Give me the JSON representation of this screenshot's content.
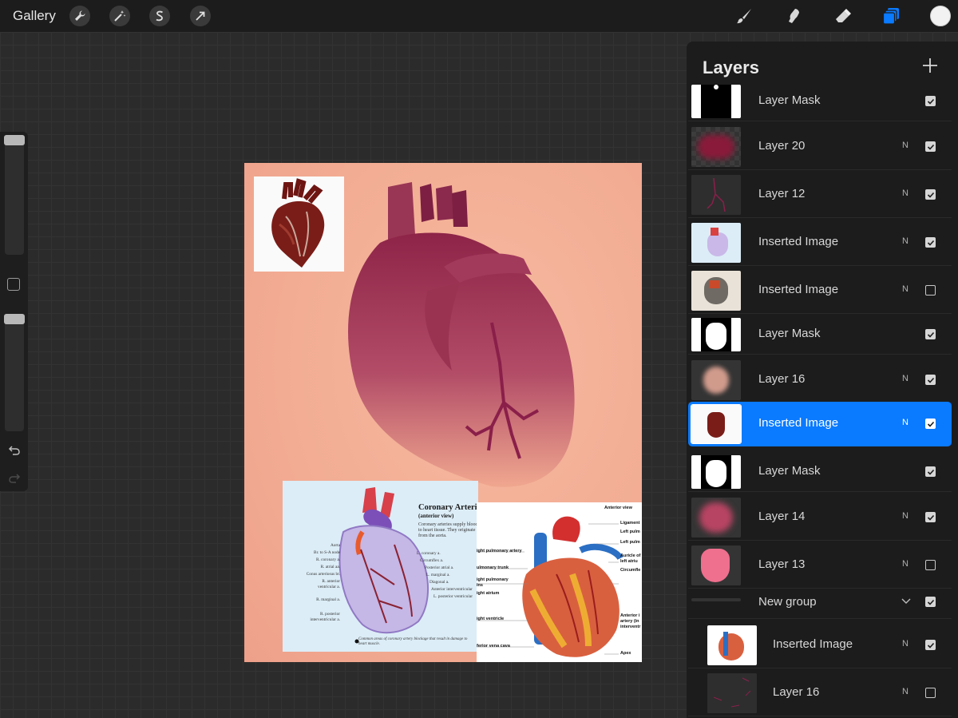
{
  "topbar": {
    "gallery_label": "Gallery",
    "tools_left": [
      "wrench-icon",
      "magic-wand-icon",
      "selection-s-icon",
      "transform-arrow-icon"
    ],
    "tools_right": [
      "brush-icon",
      "smudge-icon",
      "eraser-icon",
      "layers-icon"
    ],
    "active_tool": "layers-icon",
    "accent_color": "#0a7aff",
    "current_color": "#f2f2f2"
  },
  "sidebar": {
    "brush_size_level": 0.95,
    "opacity_level": 0.95
  },
  "artwork": {
    "diagram_left": {
      "title": "Coronary Arteries",
      "subtitle": "(anterior view)",
      "description": "Coronary arteries supply blood to heart tissue. They originate from the aorta.",
      "caption": "Common areas of coronary artery blockage that result in damage to heart muscle.",
      "labels_left": [
        "Aorta",
        "Br. to S-A node",
        "R. coronary a.",
        "R. atrial aa.",
        "Conus arteriosus br.",
        "R. anterior",
        "ventricular a.",
        "R. marginal a.",
        "R. posterior",
        "interventricular a."
      ],
      "labels_right": [
        "L. coronary a.",
        "Circumflex a.",
        "Posterior atrial a.",
        "L. marginal a.",
        "Diagonal a.",
        "Anterior interventricular",
        "L. posterior ventricular"
      ]
    },
    "diagram_right": {
      "header": "Anterior view",
      "labels_left": [
        "ight pulmonary artery",
        "ulmonary trunk",
        "ight pulmonary",
        "ins",
        "ight atrium",
        "ight ventricle",
        "ferior vena cava"
      ],
      "labels_right": [
        "Ligament",
        "Left pulm",
        "Left pulm",
        "Auricle of",
        "left atriu",
        "Circumfle",
        "Anterior i",
        "artery (in",
        "interventr",
        "Apex"
      ]
    }
  },
  "layers_panel": {
    "title": "Layers",
    "layers": [
      {
        "name": "Layer Mask",
        "blend": "",
        "visible": true,
        "thumb": "mask-top"
      },
      {
        "name": "Layer 20",
        "blend": "N",
        "visible": true,
        "thumb": "crimson-blur"
      },
      {
        "name": "Layer 12",
        "blend": "N",
        "visible": true,
        "thumb": "vessels"
      },
      {
        "name": "Inserted Image",
        "blend": "N",
        "visible": true,
        "thumb": "diagram-blue"
      },
      {
        "name": "Inserted Image",
        "blend": "N",
        "visible": false,
        "thumb": "photo-heart"
      },
      {
        "name": "Layer Mask",
        "blend": "",
        "visible": true,
        "thumb": "mask-heart"
      },
      {
        "name": "Layer 16",
        "blend": "N",
        "visible": true,
        "thumb": "pink-blur"
      },
      {
        "name": "Inserted Image",
        "blend": "N",
        "visible": true,
        "thumb": "ref-heart",
        "active": true
      },
      {
        "name": "Layer Mask",
        "blend": "",
        "visible": true,
        "thumb": "mask-heart"
      },
      {
        "name": "Layer 14",
        "blend": "N",
        "visible": true,
        "thumb": "rose-blur"
      },
      {
        "name": "Layer 13",
        "blend": "N",
        "visible": false,
        "thumb": "pink-heart"
      },
      {
        "name": "New group",
        "blend": "",
        "visible": true,
        "thumb": "group",
        "group": true
      },
      {
        "name": "Inserted Image",
        "blend": "N",
        "visible": true,
        "thumb": "diagram-color",
        "child": true
      },
      {
        "name": "Layer 16",
        "blend": "N",
        "visible": false,
        "thumb": "sketch",
        "child": true
      }
    ]
  }
}
